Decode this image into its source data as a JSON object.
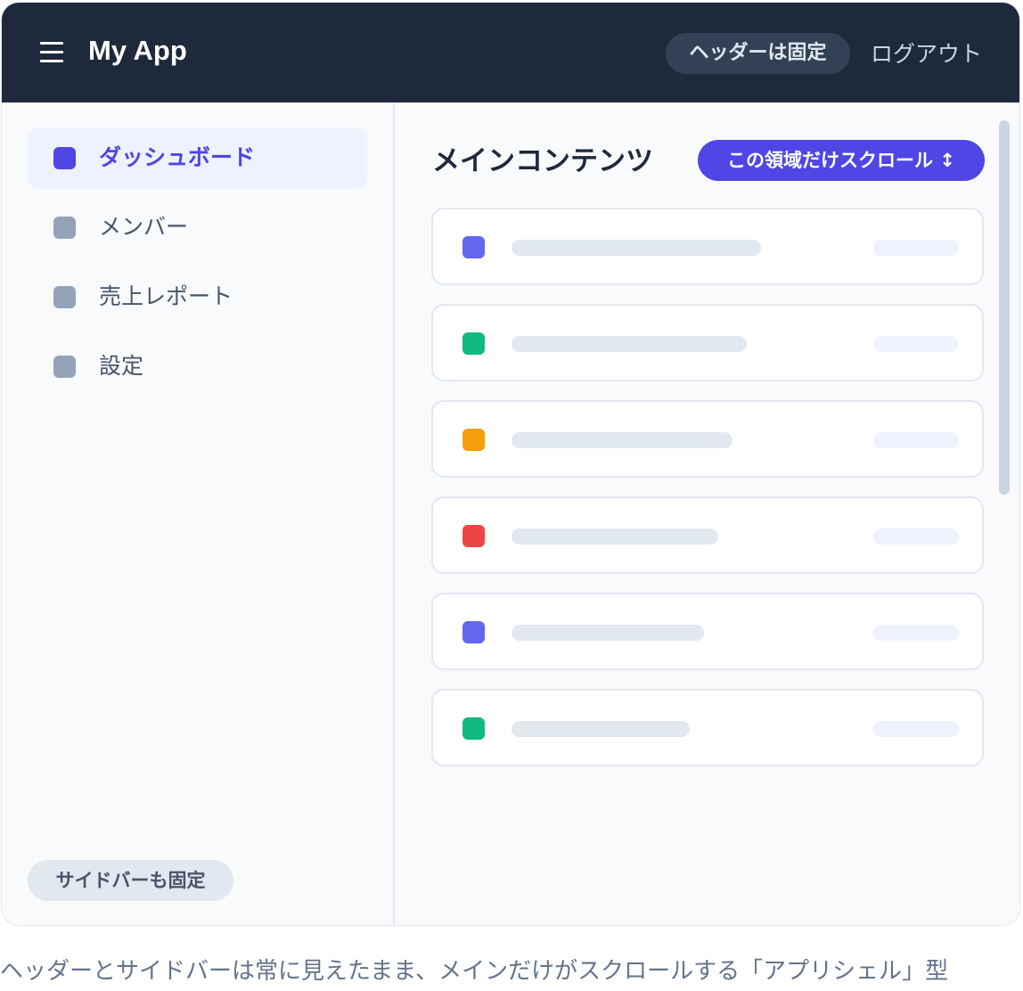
{
  "header": {
    "app_title": "My App",
    "badge": "ヘッダーは固定",
    "logout": "ログアウト",
    "menu_icon": "hamburger-menu-icon",
    "background": "#1e293b"
  },
  "sidebar": {
    "items": [
      {
        "label": "ダッシュボード",
        "active": true
      },
      {
        "label": "メンバー",
        "active": false
      },
      {
        "label": "売上レポート",
        "active": false
      },
      {
        "label": "設定",
        "active": false
      }
    ],
    "badge": "サイドバーも固定"
  },
  "main": {
    "title": "メインコンテンツ",
    "badge": "この領域だけスクロール ↕",
    "cards": [
      {
        "color": "#6366f1"
      },
      {
        "color": "#10b981"
      },
      {
        "color": "#f59e0b"
      },
      {
        "color": "#ef4444"
      },
      {
        "color": "#6366f1"
      },
      {
        "color": "#10b981"
      }
    ]
  },
  "caption": "ヘッダーとサイドバーは常に見えたまま、メインだけがスクロールする「アプリシェル」型",
  "colors": {
    "accent": "#4f46e5",
    "active_bg": "#eef2ff",
    "muted": "#94a3b8"
  }
}
